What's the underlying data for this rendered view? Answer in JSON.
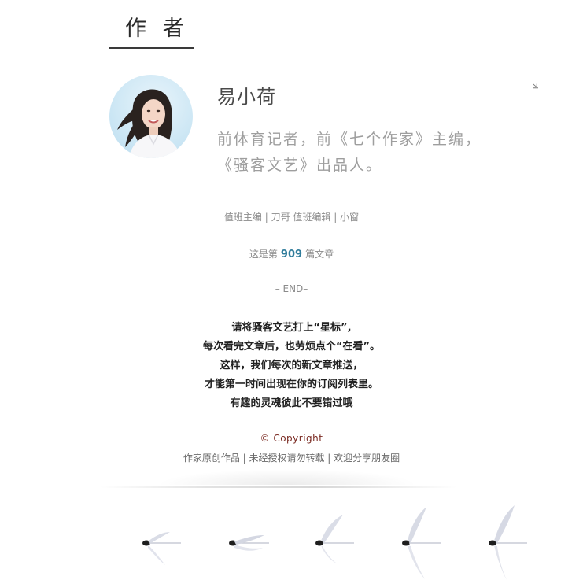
{
  "section": {
    "title": "作 者"
  },
  "author": {
    "name": "易小荷",
    "bio_line1": "前体育记者，前《七个作家》主编，",
    "bio_line2": "《骚客文艺》出品人。",
    "side_mark": "zL"
  },
  "editors": {
    "line": "值班主编 | 刀哥    值班编辑 | 小窗"
  },
  "article_count": {
    "prefix": "这是第",
    "number": "909",
    "suffix": "篇文章"
  },
  "end_marker": "– END–",
  "notice": [
    "请将骚客文艺打上“星标”,",
    "每次看完文章后，也劳烦点个“在看”。",
    "这样，我们每次的新文章推送，",
    "才能第一时间出现在你的订阅列表里。",
    "有趣的灵魂彼此不要错过哦"
  ],
  "footer": {
    "copyright": "© Copyright",
    "rights": "作家原创作品 | 未经授权请勿转载 | 欢迎分享朋友圈"
  },
  "colors": {
    "accent": "#2f7c9b",
    "copyright": "#7a2a22"
  }
}
